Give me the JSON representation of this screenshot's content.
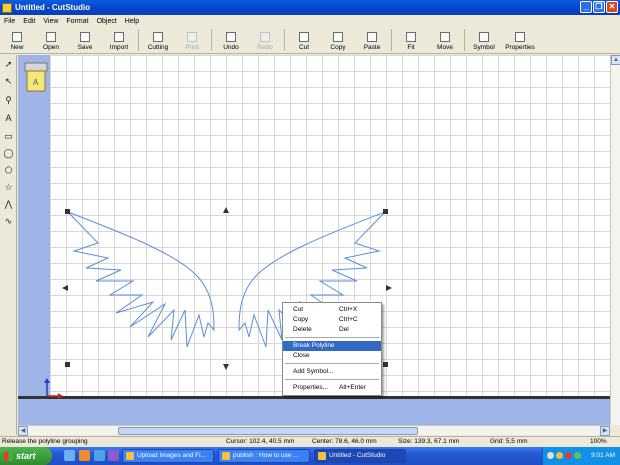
{
  "window": {
    "title": "Untitled - CutStudio",
    "controls": [
      "_",
      "❐",
      "✕"
    ]
  },
  "menu": [
    "File",
    "Edit",
    "View",
    "Format",
    "Object",
    "Help"
  ],
  "toolbar": {
    "buttons": [
      {
        "label": "New",
        "icon": "new-file-icon",
        "enabled": true
      },
      {
        "label": "Open",
        "icon": "open-folder-icon",
        "enabled": true
      },
      {
        "label": "Save",
        "icon": "save-disk-icon",
        "enabled": true
      },
      {
        "label": "Import",
        "icon": "import-icon",
        "enabled": true
      },
      {
        "label": "Cutting",
        "icon": "cutting-plotter-icon",
        "enabled": true
      },
      {
        "label": "Print",
        "icon": "print-icon",
        "enabled": false
      },
      {
        "label": "Undo",
        "icon": "undo-icon",
        "enabled": true
      },
      {
        "label": "Redo",
        "icon": "redo-icon",
        "enabled": false
      },
      {
        "label": "Cut",
        "icon": "scissors-icon",
        "enabled": true
      },
      {
        "label": "Copy",
        "icon": "copy-icon",
        "enabled": true
      },
      {
        "label": "Paste",
        "icon": "paste-icon",
        "enabled": true
      },
      {
        "label": "Fit",
        "icon": "fit-icon",
        "enabled": true
      },
      {
        "label": "Move",
        "icon": "move-icon",
        "enabled": true
      },
      {
        "label": "Symbol",
        "icon": "symbol-icon",
        "enabled": true
      },
      {
        "label": "Properties",
        "icon": "properties-icon",
        "enabled": true
      }
    ]
  },
  "tools": [
    {
      "name": "select-arrow-icon",
      "glyph": "➚"
    },
    {
      "name": "node-edit-icon",
      "glyph": "↖"
    },
    {
      "name": "zoom-icon",
      "glyph": "⚲"
    },
    {
      "name": "text-tool-icon",
      "glyph": "A"
    },
    {
      "name": "rectangle-tool-icon",
      "glyph": "▭"
    },
    {
      "name": "ellipse-tool-icon",
      "glyph": "◯"
    },
    {
      "name": "polygon-tool-icon",
      "glyph": "⬠"
    },
    {
      "name": "star-tool-icon",
      "glyph": "☆"
    },
    {
      "name": "polyline-tool-icon",
      "glyph": "⋀"
    },
    {
      "name": "freehand-tool-icon",
      "glyph": "∿"
    }
  ],
  "context_menu": {
    "items": [
      {
        "label": "Cut",
        "shortcut": "Ctrl+X",
        "selected": false
      },
      {
        "label": "Copy",
        "shortcut": "Ctrl+C",
        "selected": false
      },
      {
        "label": "Delete",
        "shortcut": "Del",
        "selected": false
      },
      {
        "separator": true
      },
      {
        "label": "Break Polyline",
        "shortcut": "",
        "selected": true
      },
      {
        "label": "Close",
        "shortcut": "",
        "selected": false
      },
      {
        "separator": true
      },
      {
        "label": "Add Symbol...",
        "shortcut": "",
        "selected": false
      },
      {
        "separator": true
      },
      {
        "label": "Properties...",
        "shortcut": "Alt+Enter",
        "selected": false
      }
    ]
  },
  "status": {
    "message": "Release the polyline grouping",
    "cursor": "Cursor: 102.4, 40.5 mm",
    "center": "Center: 78.6, 46.0 mm",
    "size": "Size: 139.3, 67.1 mm",
    "grid": "Grid: 5,5 mm",
    "zoom": "100%"
  },
  "taskbar": {
    "start": "start",
    "tasks": [
      {
        "label": "Upload Images and Fi...",
        "active": false
      },
      {
        "label": "publish : How to use ...",
        "active": false
      },
      {
        "label": "Untitled - CutStudio",
        "active": true
      }
    ],
    "clock": "9:01 AM"
  },
  "colors": {
    "title_bar": "#0a5ddc",
    "canvas_margin": "#9fb4e6",
    "wing_stroke": "#5b8fd8",
    "menu_highlight": "#316ac5",
    "taskbar": "#2458d3"
  }
}
